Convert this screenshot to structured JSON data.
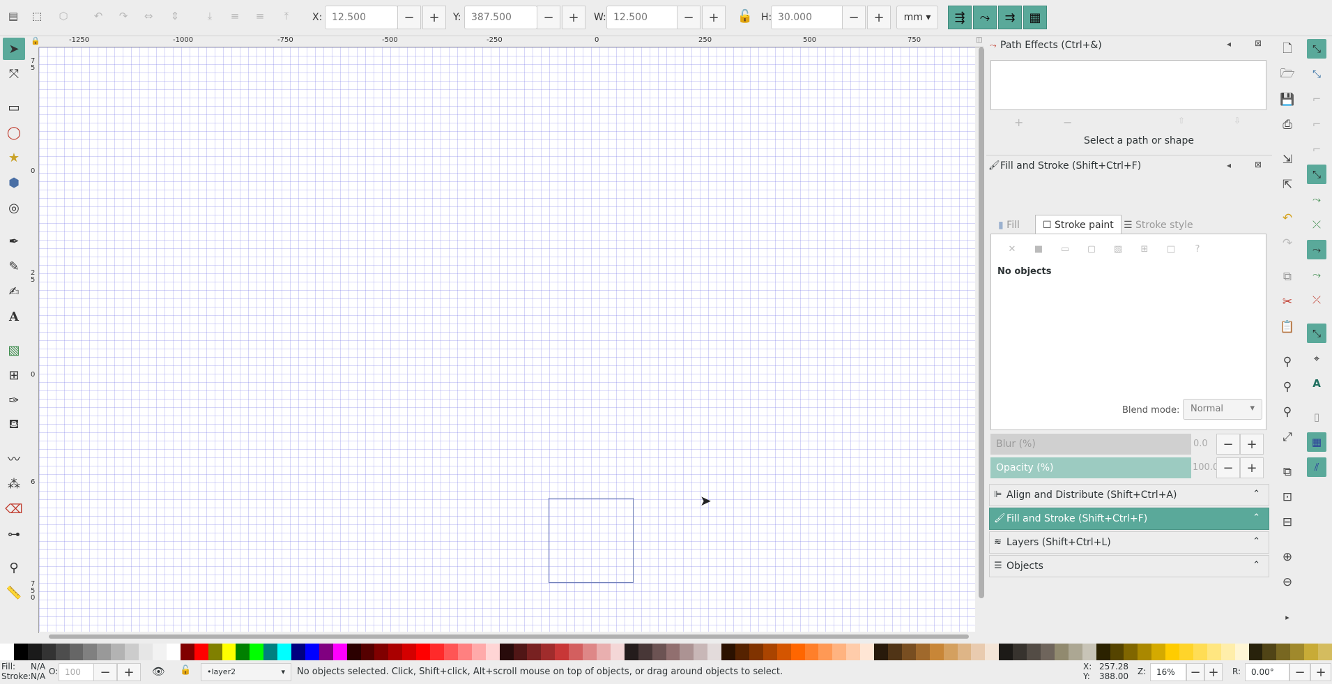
{
  "toolbar": {
    "x_label": "X:",
    "x_value": "12.500",
    "y_label": "Y:",
    "y_value": "387.500",
    "w_label": "W:",
    "w_value": "12.500",
    "h_label": "H:",
    "h_value": "30.000",
    "unit": "mm",
    "minus": "−",
    "plus": "+"
  },
  "ruler": {
    "h_ticks": [
      "-1250",
      "-1000",
      "-750",
      "-500",
      "-250",
      "0",
      "250",
      "500",
      "750"
    ],
    "v_ticks": [
      "7",
      "5",
      "0",
      "2",
      "5",
      "0",
      "6",
      "7",
      "5",
      "0"
    ]
  },
  "path_effects": {
    "title": "Path Effects (Ctrl+&)",
    "status": "Select a path or shape"
  },
  "fill_stroke": {
    "title": "Fill and Stroke (Shift+Ctrl+F)",
    "tabs": [
      "Fill",
      "Stroke paint",
      "Stroke style"
    ],
    "active_tab": "Stroke paint",
    "no_objects": "No objects",
    "blend_label": "Blend mode:",
    "blend_value": "Normal",
    "blur_label": "Blur (%)",
    "blur_value": "0.0",
    "opacity_label": "Opacity (%)",
    "opacity_value": "100.0"
  },
  "accordion": [
    {
      "label": "Align and Distribute (Shift+Ctrl+A)",
      "active": false
    },
    {
      "label": "Fill and Stroke (Shift+Ctrl+F)",
      "active": true
    },
    {
      "label": "Layers (Shift+Ctrl+L)",
      "active": false
    },
    {
      "label": "Objects",
      "active": false
    }
  ],
  "status": {
    "fill_label": "Fill:",
    "fill_value": "N/A",
    "stroke_label": "Stroke:",
    "stroke_value": "N/A",
    "o_label": "O:",
    "o_value": "100",
    "layer": "•layer2",
    "message": "No objects selected. Click, Shift+click, Alt+scroll mouse on top of objects, or drag around objects to select.",
    "x_label": "X:",
    "x_value": "257.28",
    "y_label": "Y:",
    "y_value": "388.00",
    "z_label": "Z:",
    "z_value": "16%",
    "r_label": "R:",
    "r_value": "0.00°"
  },
  "palette": [
    "#ffffff",
    "#000000",
    "#1a1a1a",
    "#333333",
    "#4d4d4d",
    "#666666",
    "#808080",
    "#999999",
    "#b3b3b3",
    "#cccccc",
    "#e6e6e6",
    "#f2f2f2",
    "#ffffff",
    "#800000",
    "#ff0000",
    "#808000",
    "#ffff00",
    "#008000",
    "#00ff00",
    "#008080",
    "#00ffff",
    "#000080",
    "#0000ff",
    "#800080",
    "#ff00ff",
    "#2b0000",
    "#550000",
    "#800000",
    "#aa0000",
    "#d40000",
    "#ff0000",
    "#ff2a2a",
    "#ff5555",
    "#ff8080",
    "#ffaaaa",
    "#ffd5d5",
    "#280b0b",
    "#501616",
    "#782121",
    "#a02c2c",
    "#c83737",
    "#d35f5f",
    "#de8787",
    "#e9afaf",
    "#f4d7d7",
    "#241c1c",
    "#483737",
    "#6c5353",
    "#916f6f",
    "#ac9393",
    "#c8b7b7",
    "#e3dbdb",
    "#2b1100",
    "#552200",
    "#803300",
    "#aa4400",
    "#d45500",
    "#ff6600",
    "#ff7f2a",
    "#ff9955",
    "#ffb380",
    "#ffccaa",
    "#ffe6d5",
    "#281a0b",
    "#503416",
    "#784e21",
    "#a0692c",
    "#c88637",
    "#d4a05f",
    "#deb587",
    "#e9cbaf",
    "#f4e5d7",
    "#1c1a17",
    "#37332e",
    "#534c45",
    "#6f655c",
    "#918a6f",
    "#aca793",
    "#c8c4b7",
    "#2b2200",
    "#554400",
    "#806600",
    "#aa8800",
    "#d4aa00",
    "#ffcc00",
    "#ffd42a",
    "#ffdd55",
    "#ffe680",
    "#ffeeaa",
    "#fff6d5",
    "#28220b",
    "#504416",
    "#786721",
    "#a0892c",
    "#c8ab37",
    "#d4bc5f"
  ]
}
